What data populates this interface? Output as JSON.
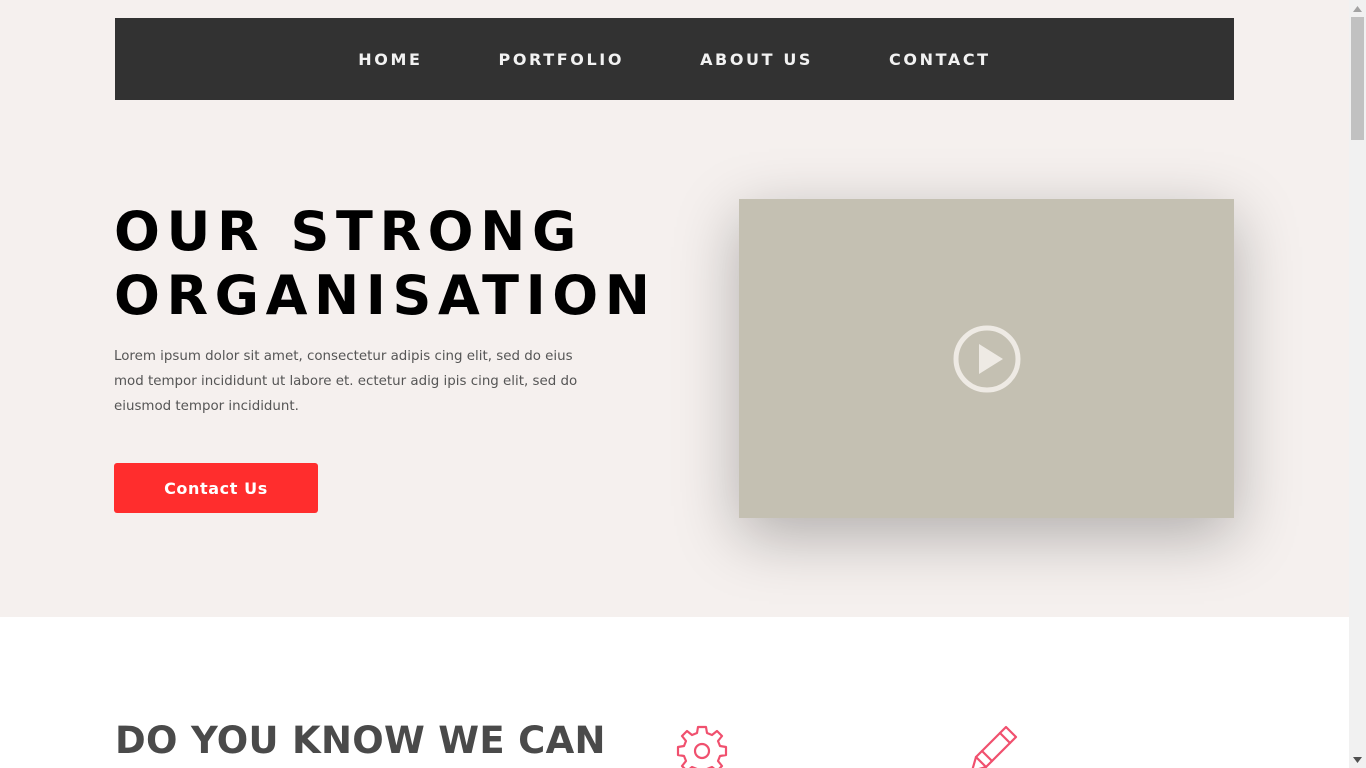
{
  "nav": {
    "items": [
      {
        "label": "HOME"
      },
      {
        "label": "PORTFOLIO"
      },
      {
        "label": "ABOUT US"
      },
      {
        "label": "CONTACT"
      }
    ]
  },
  "hero": {
    "title_line1": "OUR STRONG",
    "title_line2": "ORGANISATION",
    "text": "Lorem ipsum dolor sit amet, consectetur adipis cing elit, sed do eius mod tempor incididunt ut labore et. ectetur adig ipis cing elit, sed do eiusmod tempor incididunt.",
    "cta_label": "Contact Us",
    "video_icon": "play-circle-icon"
  },
  "section": {
    "title": "DO YOU KNOW WE CAN",
    "icons": [
      "gear-icon",
      "pencil-icon"
    ]
  },
  "colors": {
    "nav_bg": "#323232",
    "page_bg": "#f5f0ee",
    "accent": "#ff2d2d",
    "video_bg": "#c4c0b2",
    "icon_accent": "#f0506e"
  }
}
